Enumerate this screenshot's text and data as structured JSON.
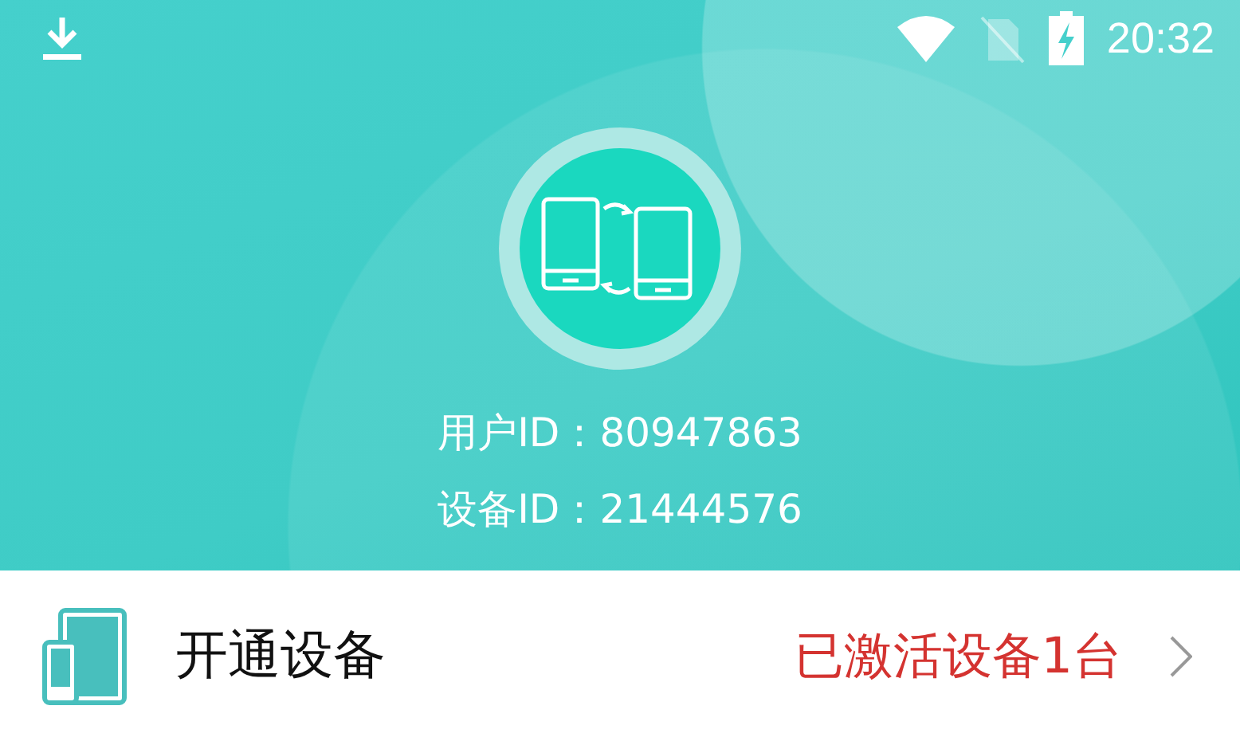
{
  "status_bar": {
    "time": "20:32"
  },
  "profile": {
    "user_id_label": "用户ID：",
    "user_id": "80947863",
    "device_id_label": "设备ID：",
    "device_id": "21444576"
  },
  "menu": [
    {
      "title": "开通设备",
      "status": "已激活设备1台"
    }
  ]
}
